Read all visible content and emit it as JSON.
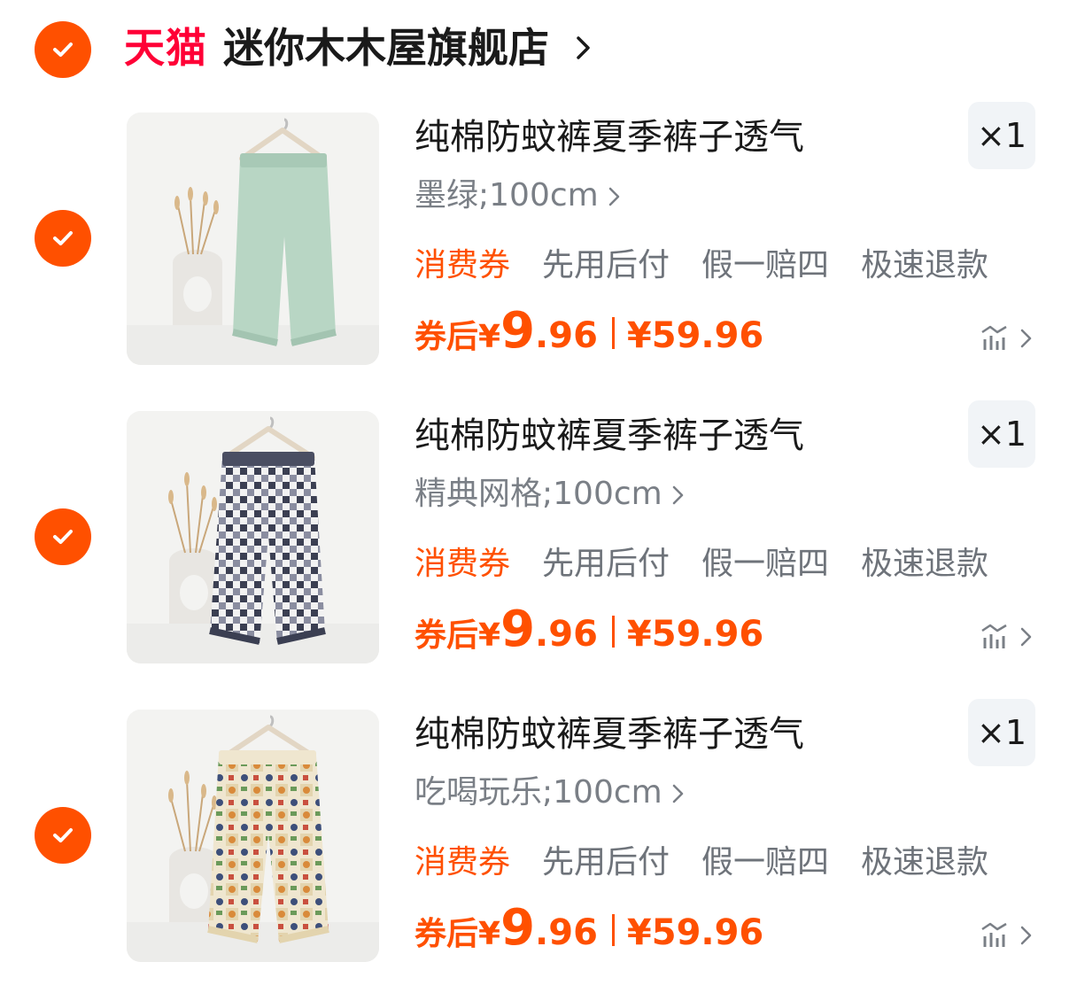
{
  "store": {
    "platform": "天猫",
    "name": "迷你木木屋旗舰店",
    "selected": true,
    "icons": {
      "check": "check-icon",
      "chevron": "chevron-right-icon"
    }
  },
  "items": [
    {
      "title": "纯棉防蚊裤夏季裤子透气",
      "quantity": "×1",
      "sku": "墨绿;100cm",
      "tags": {
        "coupon": "消费券",
        "pay_later": "先用后付",
        "fake_guarantee": "假一赔四",
        "fast_refund": "极速退款"
      },
      "price": {
        "label": "券后",
        "currency": "¥",
        "integer": "9",
        "decimal": ".96",
        "original": "¥59.96"
      },
      "selected": true,
      "image": "mint-green-pants"
    },
    {
      "title": "纯棉防蚊裤夏季裤子透气",
      "quantity": "×1",
      "sku": "精典网格;100cm",
      "tags": {
        "coupon": "消费券",
        "pay_later": "先用后付",
        "fake_guarantee": "假一赔四",
        "fast_refund": "极速退款"
      },
      "price": {
        "label": "券后",
        "currency": "¥",
        "integer": "9",
        "decimal": ".96",
        "original": "¥59.96"
      },
      "selected": true,
      "image": "plaid-pants"
    },
    {
      "title": "纯棉防蚊裤夏季裤子透气",
      "quantity": "×1",
      "sku": "吃喝玩乐;100cm",
      "tags": {
        "coupon": "消费券",
        "pay_later": "先用后付",
        "fake_guarantee": "假一赔四",
        "fast_refund": "极速退款"
      },
      "price": {
        "label": "券后",
        "currency": "¥",
        "integer": "9",
        "decimal": ".96",
        "original": "¥59.96"
      },
      "selected": true,
      "image": "cartoon-print-pants"
    }
  ],
  "colors": {
    "accent": "#ff5000",
    "tmall": "#ff0036",
    "muted_text": "#7a7f86",
    "qty_bg": "#f1f4f7"
  }
}
